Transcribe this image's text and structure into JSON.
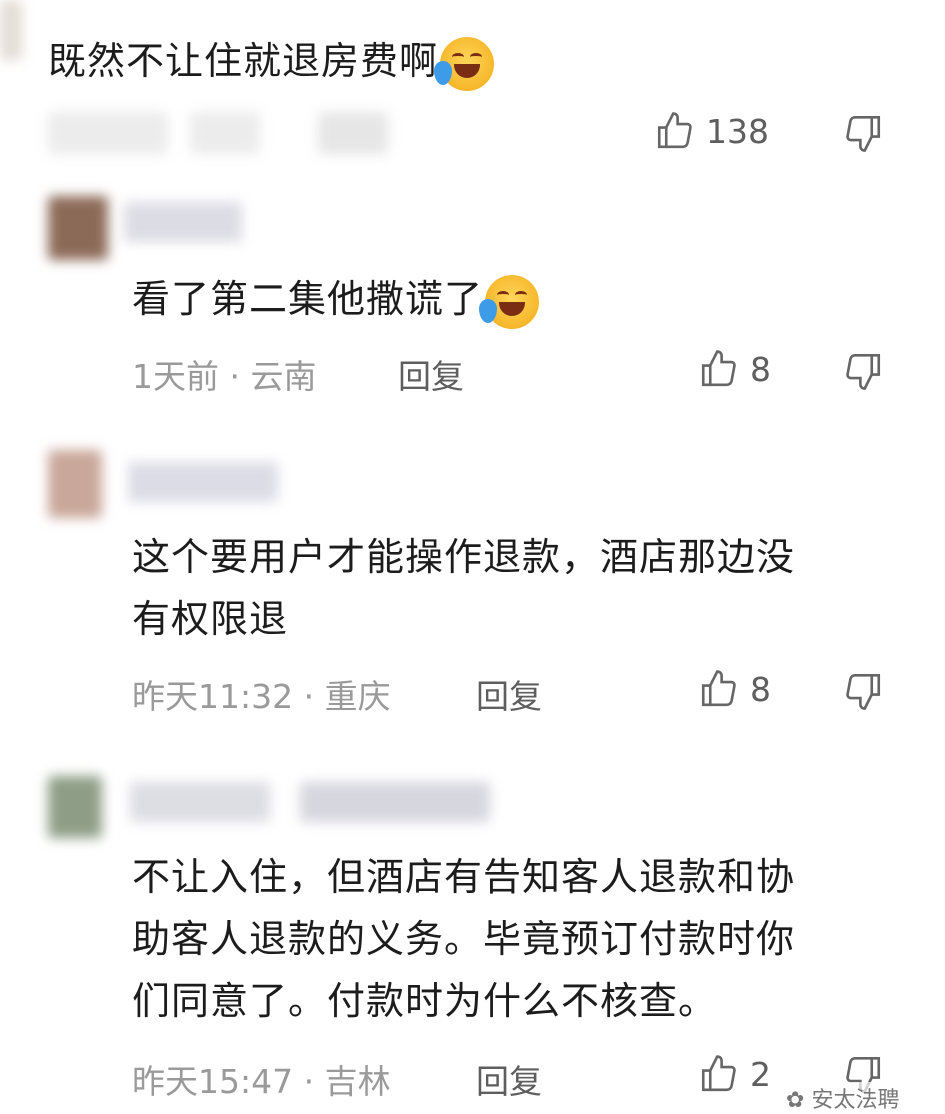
{
  "comments": [
    {
      "text_lines": [
        "既然不让住就退房费啊"
      ],
      "has_emoji": true,
      "like_count": "138"
    },
    {
      "text_lines": [
        "看了第二集他撒谎了"
      ],
      "has_emoji": true,
      "meta": "1天前 · 云南",
      "reply_label": "回复",
      "like_count": "8"
    },
    {
      "text_lines": [
        "这个要用户才能操作退款，酒店那边没",
        "有权限退"
      ],
      "has_emoji": false,
      "meta": "昨天11:32 · 重庆",
      "reply_label": "回复",
      "like_count": "8"
    },
    {
      "text_lines": [
        "不让入住，但酒店有告知客人退款和协",
        "助客人退款的义务。毕竟预订付款时你",
        "们同意了。付款时为什么不核查。"
      ],
      "has_emoji": false,
      "meta": "昨天15:47 · 吉林",
      "reply_label": "回复",
      "like_count": "2"
    }
  ],
  "watermark": "安太法聘",
  "icons": {
    "like": "thumbs-up-icon",
    "dislike": "thumbs-down-icon",
    "emoji": "laughing-crying-emoji"
  },
  "colors": {
    "text": "#1c1c1c",
    "meta": "#9a9a9a",
    "action": "#5e5e5e"
  }
}
